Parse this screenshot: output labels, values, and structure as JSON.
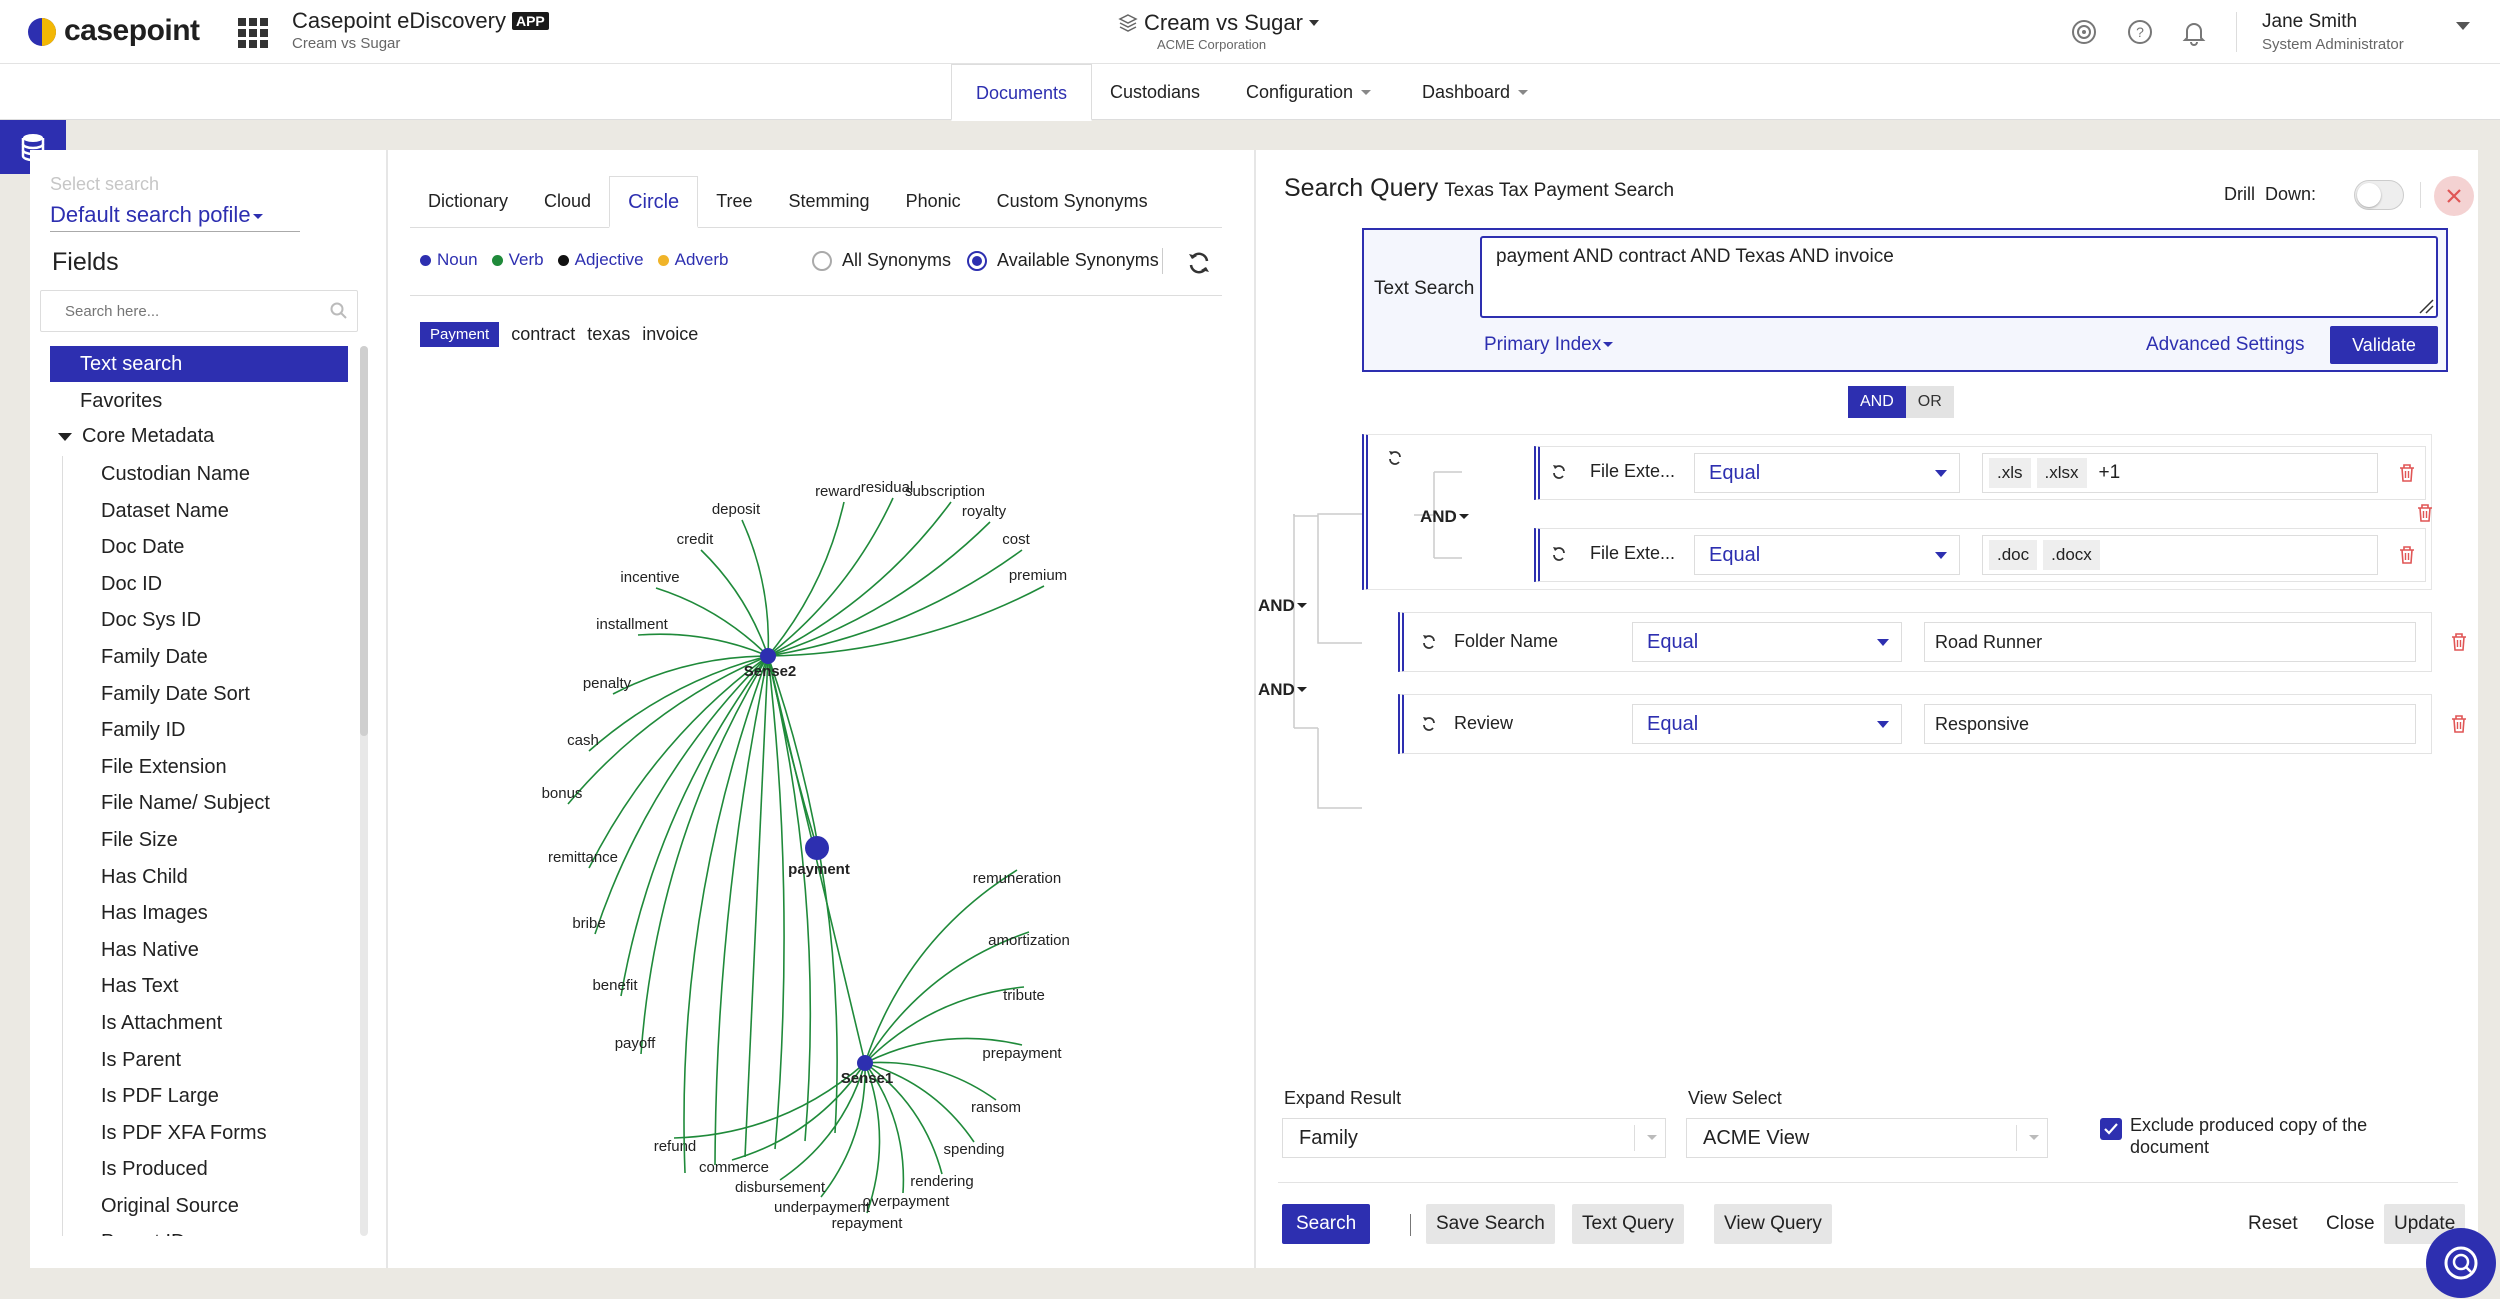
{
  "header": {
    "brand": "casepoint",
    "app_title": "Casepoint eDiscovery",
    "app_badge": "APP",
    "app_subtitle": "Cream vs Sugar",
    "case_title": "Cream vs Sugar",
    "case_org": "ACME Corporation",
    "user_name": "Jane Smith",
    "user_role": "System Administrator"
  },
  "nav": {
    "items": [
      "Documents",
      "Custodians",
      "Configuration",
      "Dashboard"
    ],
    "active": "Documents"
  },
  "fields_panel": {
    "select_search_label": "Select search",
    "profile": "Default search pofile",
    "title": "Fields",
    "search_placeholder": "Search here...",
    "active_item": "Text search",
    "favorites": "Favorites",
    "group": "Core Metadata",
    "items": [
      "Custodian Name",
      "Dataset Name",
      "Doc Date",
      "Doc ID",
      "Doc Sys ID",
      "Family Date",
      "Family Date Sort",
      "Family ID",
      "File Extension",
      "File Name/ Subject",
      "File Size",
      "Has Child",
      "Has Images",
      "Has Native",
      "Has Text",
      "Is Attachment",
      "Is Parent",
      "Is PDF Large",
      "Is PDF XFA Forms",
      "Is Produced",
      "Original Source",
      "Parent ID"
    ]
  },
  "synonyms": {
    "tabs": [
      "Dictionary",
      "Cloud",
      "Circle",
      "Tree",
      "Stemming",
      "Phonic",
      "Custom Synonyms"
    ],
    "active_tab": "Circle",
    "legend": [
      {
        "label": "Noun",
        "color": "#2d2fb0"
      },
      {
        "label": "Verb",
        "color": "#1f8a3a"
      },
      {
        "label": "Adjective",
        "color": "#111111"
      },
      {
        "label": "Adverb",
        "color": "#f0b429"
      }
    ],
    "radio_all": "All Synonyms",
    "radio_available": "Available Synonyms",
    "chips": [
      "Payment",
      "contract",
      "texas",
      "invoice"
    ],
    "graph": {
      "center": "payment",
      "sense2": "Sense2",
      "sense1": "Sense1",
      "sense2_words": [
        "deposit",
        "reward",
        "residual",
        "subscription",
        "royalty",
        "cost",
        "premium",
        "credit",
        "incentive",
        "installment",
        "penalty",
        "cash",
        "bonus",
        "remittance",
        "bribe",
        "benefit",
        "payoff"
      ],
      "sense1_words": [
        "remuneration",
        "amortization",
        "tribute",
        "prepayment",
        "ransom",
        "spending",
        "rendering",
        "overpayment",
        "repayment",
        "underpayment",
        "disbursement",
        "commerce",
        "refund"
      ]
    }
  },
  "query": {
    "title": "Search Query",
    "name": "Texas Tax Payment Search",
    "drill_down": "Drill  Down:",
    "text_search_label": "Text Search",
    "text_search_value": "payment AND contract AND Texas AND invoice",
    "primary_index": "Primary Index",
    "advanced_settings": "Advanced Settings",
    "validate": "Validate",
    "and": "AND",
    "or": "OR",
    "group_op": "AND",
    "outer_op1": "AND",
    "outer_op2": "AND",
    "rules": [
      {
        "field": "File Exte...",
        "operator": "Equal",
        "values": [
          ".xls",
          ".xlsx"
        ],
        "more": "+1"
      },
      {
        "field": "File Exte...",
        "operator": "Equal",
        "values": [
          ".doc",
          ".docx"
        ]
      },
      {
        "field": "Folder Name",
        "operator": "Equal",
        "value": "Road Runner"
      },
      {
        "field": "Review",
        "operator": "Equal",
        "value": "Responsive"
      }
    ],
    "expand_result_label": "Expand Result",
    "expand_result_value": "Family",
    "view_select_label": "View Select",
    "view_select_value": "ACME View",
    "exclude_label": "Exclude produced copy of the document",
    "buttons": {
      "search": "Search",
      "save_search": "Save Search",
      "text_query": "Text Query",
      "view_query": "View Query",
      "reset": "Reset",
      "close": "Close",
      "update": "Update"
    }
  }
}
